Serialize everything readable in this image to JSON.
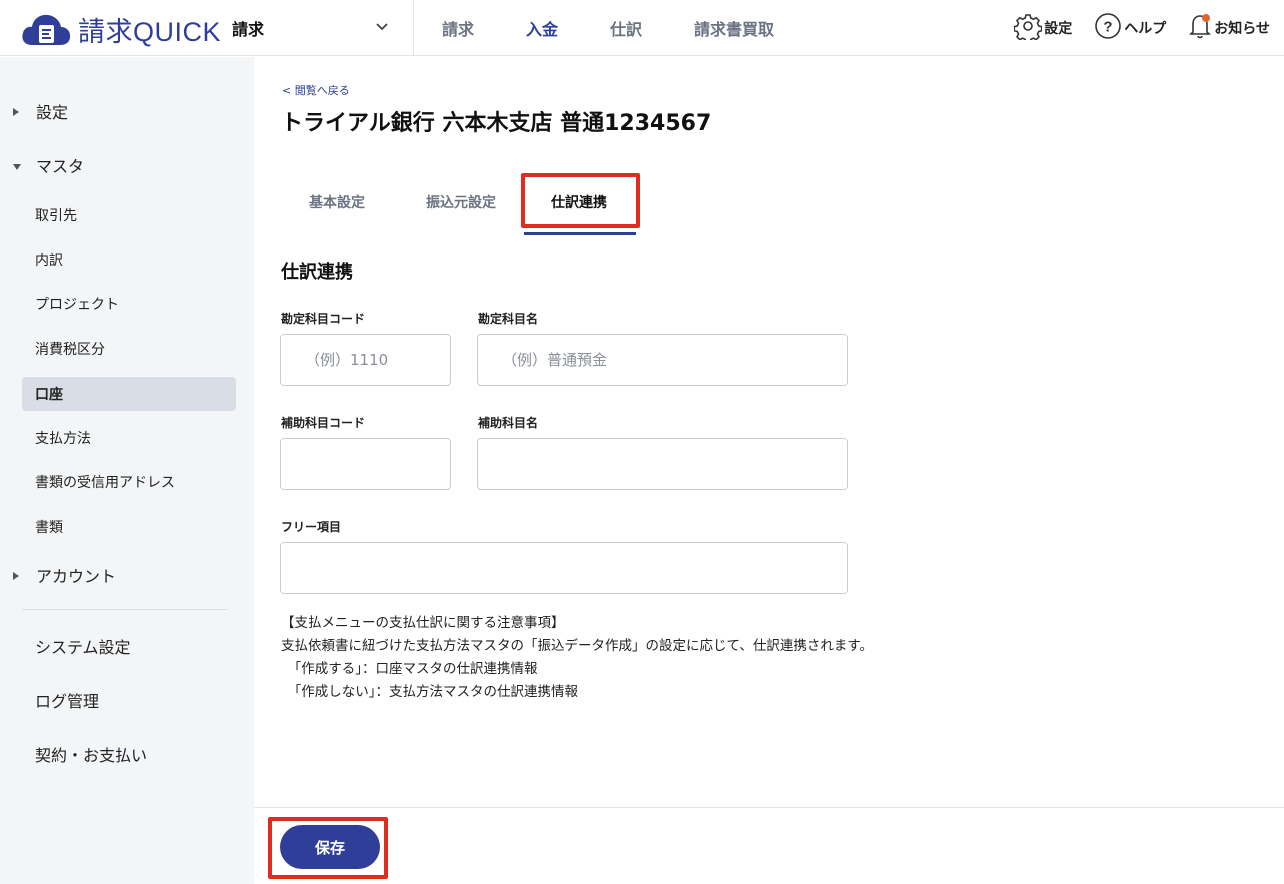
{
  "header": {
    "logo_text": "請求QUICK",
    "product_label": "請求",
    "nav": [
      "請求",
      "入金",
      "仕訳",
      "請求書買取"
    ],
    "active_nav_index": 1,
    "settings_label": "設定",
    "help_label": "ヘルプ",
    "notifications_label": "お知らせ"
  },
  "sidebar": {
    "groups": {
      "settings": "設定",
      "master": "マスタ",
      "account": "アカウント"
    },
    "master_items": [
      "取引先",
      "内訳",
      "プロジェクト",
      "消費税区分",
      "口座",
      "支払方法",
      "書類の受信用アドレス",
      "書類"
    ],
    "active_item": "口座",
    "bottom_items": [
      "システム設定",
      "ログ管理",
      "契約・お支払い"
    ]
  },
  "main": {
    "back_link": "< 閲覧へ戻る",
    "title": "トライアル銀行 六本木支店 普通1234567",
    "tabs": [
      "基本設定",
      "振込元設定",
      "仕訳連携"
    ],
    "active_tab": "仕訳連携",
    "section_title": "仕訳連携",
    "fields": {
      "account_code_label": "勘定科目コード",
      "account_code_placeholder": "（例）1110",
      "account_name_label": "勘定科目名",
      "account_name_placeholder": "（例）普通預金",
      "sub_code_label": "補助科目コード",
      "sub_name_label": "補助科目名",
      "free_label": "フリー項目"
    },
    "notes": [
      "【支払メニューの支払仕訳に関する注意事項】",
      "支払依頼書に紐づけた支払方法マスタの「振込データ作成」の設定に応じて、仕訳連携されます。",
      "　「作成する」：口座マスタの仕訳連携情報",
      "　「作成しない」：支払方法マスタの仕訳連携情報"
    ]
  },
  "footer": {
    "save_label": "保存"
  },
  "colors": {
    "brand": "#2f3f99",
    "highlight": "#e22b20",
    "sidebar_bg": "#f4f5f7",
    "notification_dot": "#e0662e"
  },
  "icons": [
    "cloud-logo-icon",
    "chevron-down-icon",
    "gear-icon",
    "help-circle-icon",
    "bell-icon",
    "caret-right-icon",
    "caret-down-icon"
  ]
}
